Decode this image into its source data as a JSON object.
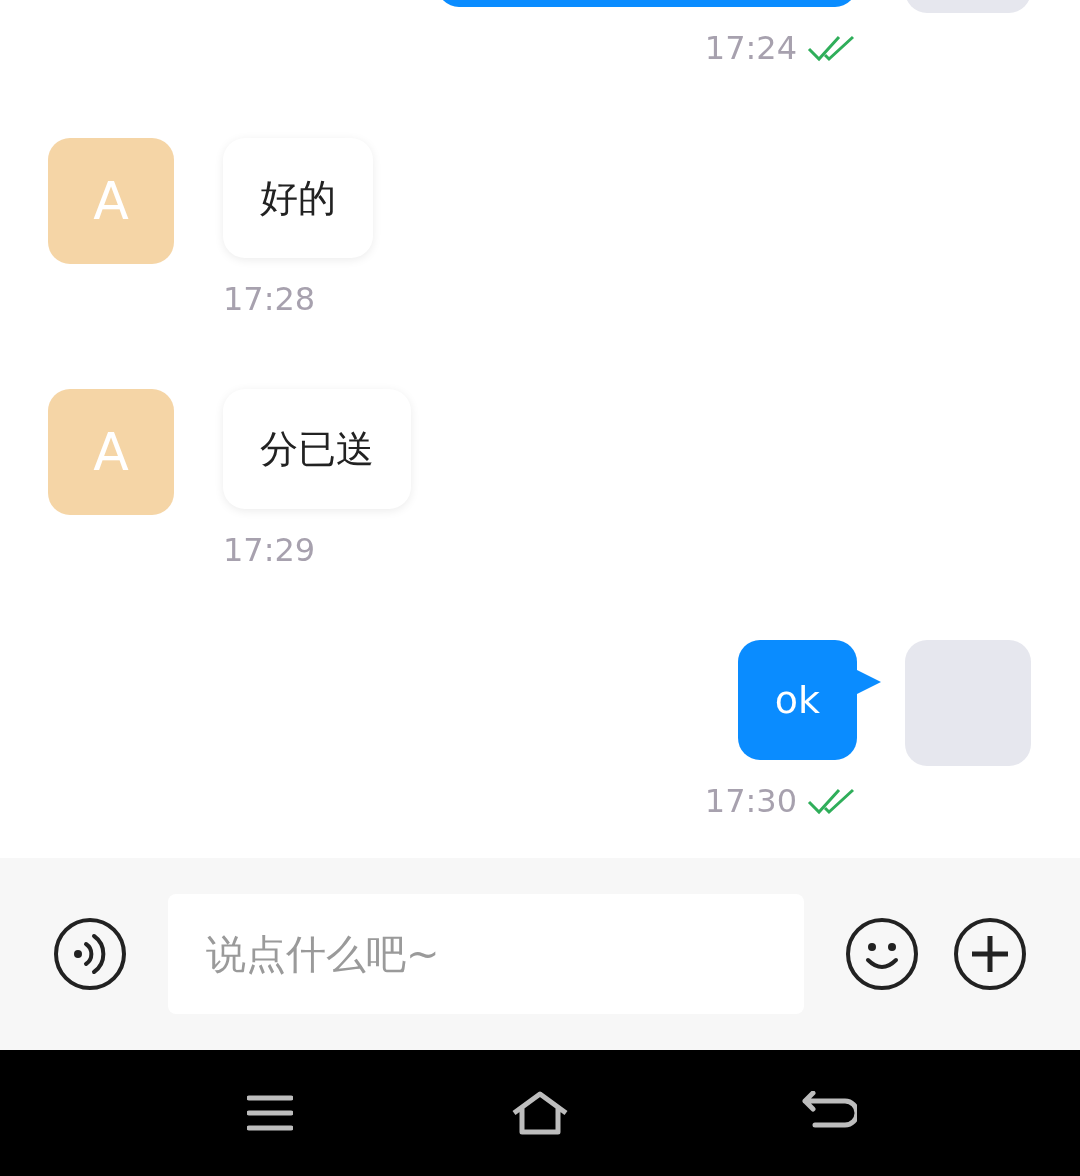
{
  "messages": [
    {
      "kind": "outgoing",
      "time": "17:24",
      "read": true
    },
    {
      "kind": "incoming",
      "avatar": "A",
      "text": "好的",
      "time": "17:28"
    },
    {
      "kind": "incoming",
      "avatar": "A",
      "text": "分已送",
      "time": "17:29"
    },
    {
      "kind": "outgoing",
      "text": "ok",
      "time": "17:30",
      "read": true
    }
  ],
  "composer": {
    "placeholder": "说点什么吧~"
  }
}
